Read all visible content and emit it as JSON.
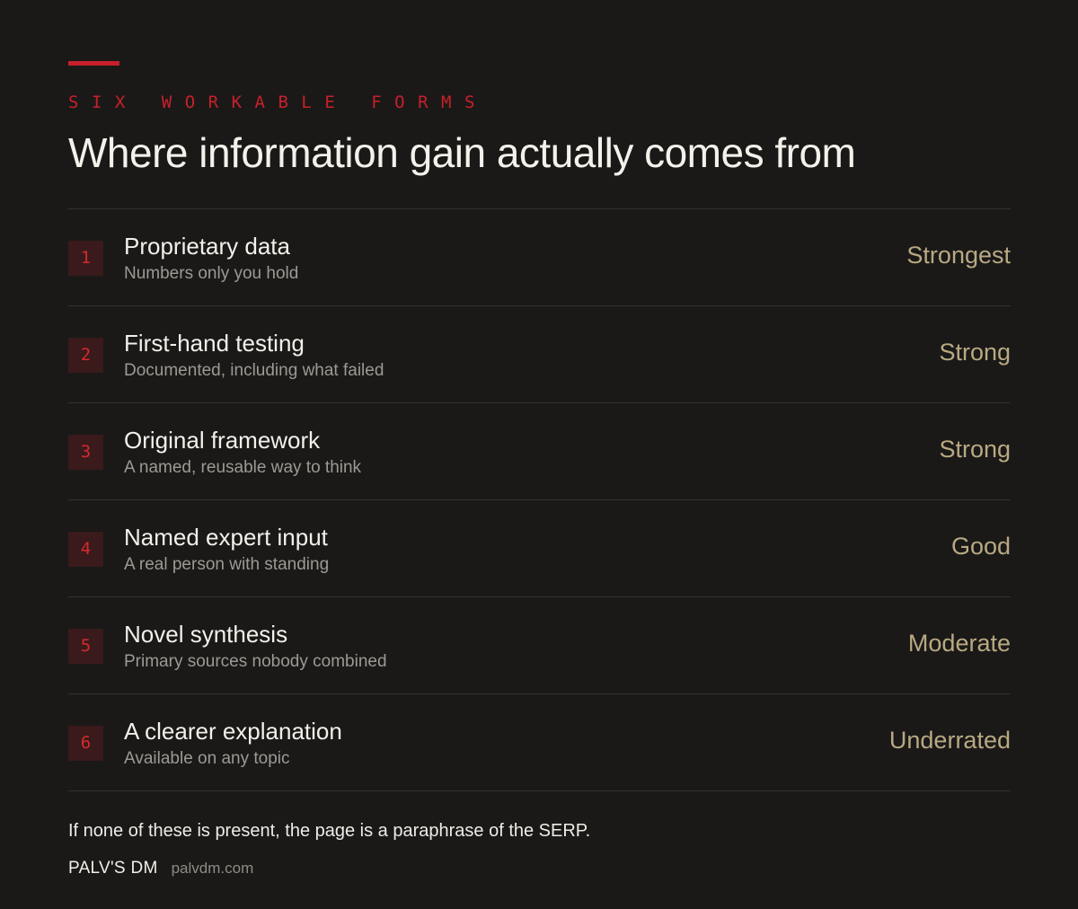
{
  "header": {
    "eyebrow": "SIX WORKABLE FORMS",
    "title": "Where information gain actually comes from"
  },
  "items": [
    {
      "number": "1",
      "title": "Proprietary data",
      "subtitle": "Numbers only you hold",
      "rating": "Strongest"
    },
    {
      "number": "2",
      "title": "First-hand testing",
      "subtitle": "Documented, including what failed",
      "rating": "Strong"
    },
    {
      "number": "3",
      "title": "Original framework",
      "subtitle": "A named, reusable way to think",
      "rating": "Strong"
    },
    {
      "number": "4",
      "title": "Named expert input",
      "subtitle": "A real person with standing",
      "rating": "Good"
    },
    {
      "number": "5",
      "title": "Novel synthesis",
      "subtitle": "Primary sources nobody combined",
      "rating": "Moderate"
    },
    {
      "number": "6",
      "title": "A clearer explanation",
      "subtitle": "Available on any topic",
      "rating": "Underrated"
    }
  ],
  "footer": {
    "note": "If none of these is present, the page is a paraphrase of the SERP.",
    "brand": "PALV'S DM",
    "url": "palvdm.com"
  },
  "colors": {
    "background": "#1a1918",
    "accent": "#c8202a",
    "number_badge_bg": "#3a1a1b",
    "rating": "#b9a982",
    "subtitle": "#9d9993",
    "divider": "#34322f"
  }
}
